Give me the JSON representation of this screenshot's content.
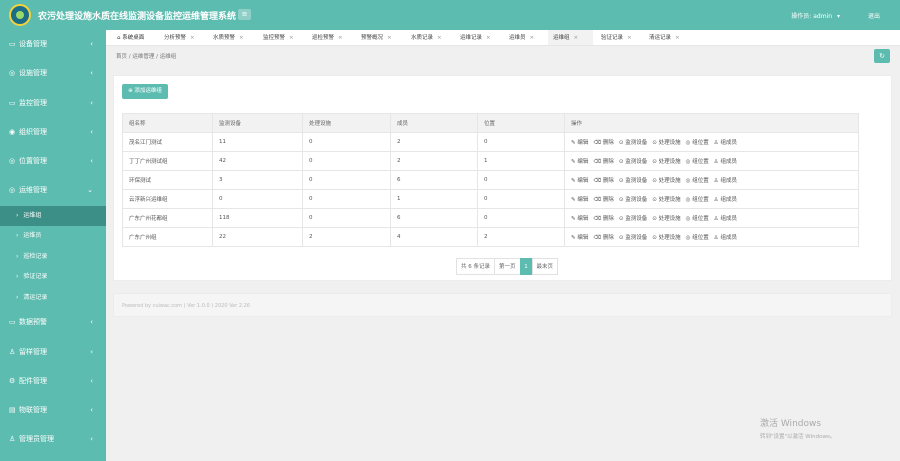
{
  "header": {
    "title": "农污处理设施水质在线监测设备监控运维管理系统",
    "operator_label": "操作员:",
    "user": "admin",
    "logout": "退出"
  },
  "sidebar": {
    "items": [
      {
        "label": "设备管理",
        "icon": "device-icon",
        "sub": []
      },
      {
        "label": "设施管理",
        "icon": "facility-icon",
        "sub": []
      },
      {
        "label": "监控管理",
        "icon": "monitor-icon",
        "sub": []
      },
      {
        "label": "组织管理",
        "icon": "org-icon",
        "sub": []
      },
      {
        "label": "位置管理",
        "icon": "location-icon",
        "sub": []
      },
      {
        "label": "运维管理",
        "icon": "maintenance-icon",
        "expanded": true,
        "sub": [
          {
            "label": "运维组",
            "active": true
          },
          {
            "label": "运维员",
            "active": false
          },
          {
            "label": "巡检记录",
            "active": false
          },
          {
            "label": "验证记录",
            "active": false
          },
          {
            "label": "清运记录",
            "active": false
          }
        ]
      },
      {
        "label": "数据预警",
        "icon": "alert-icon",
        "sub": []
      },
      {
        "label": "留样管理",
        "icon": "sample-icon",
        "sub": []
      },
      {
        "label": "配件管理",
        "icon": "parts-icon",
        "sub": []
      },
      {
        "label": "物联管理",
        "icon": "iot-icon",
        "sub": []
      },
      {
        "label": "管理员管理",
        "icon": "admin-icon",
        "sub": []
      }
    ]
  },
  "tabs": [
    {
      "label": "系统桌面",
      "home": true
    },
    {
      "label": "分析预警"
    },
    {
      "label": "水质预警"
    },
    {
      "label": "监控预警"
    },
    {
      "label": "巡检预警"
    },
    {
      "label": "预警概况"
    },
    {
      "label": "水质记录"
    },
    {
      "label": "运维记录"
    },
    {
      "label": "运维员"
    },
    {
      "label": "运维组",
      "active": true
    },
    {
      "label": "验证记录"
    },
    {
      "label": "清运记录"
    }
  ],
  "breadcrumb": {
    "home": "首页",
    "parent": "运维管理",
    "current": "运维组"
  },
  "add_button": "添加运维组",
  "table": {
    "headers": [
      "组名称",
      "监测设备",
      "处理设施",
      "成员",
      "位置",
      "操作"
    ],
    "actions": [
      "编辑",
      "删除",
      "监测设备",
      "处理设施",
      "组位置",
      "组成员"
    ],
    "rows": [
      {
        "name": "茂名江门测试",
        "monitor": "11",
        "facility": "0",
        "members": "2",
        "location": "0"
      },
      {
        "name": "丁丁广州测试组",
        "monitor": "42",
        "facility": "0",
        "members": "2",
        "location": "1"
      },
      {
        "name": "环保测试",
        "monitor": "3",
        "facility": "0",
        "members": "6",
        "location": "0"
      },
      {
        "name": "云浮新兴运维组",
        "monitor": "0",
        "facility": "0",
        "members": "1",
        "location": "0"
      },
      {
        "name": "广东广州花都组",
        "monitor": "118",
        "facility": "0",
        "members": "6",
        "location": "0"
      },
      {
        "name": "广东广州组",
        "monitor": "22",
        "facility": "2",
        "members": "4",
        "location": "2"
      }
    ]
  },
  "pagination": {
    "total": "共 6 条记录",
    "first": "第一页",
    "current": "1",
    "last": "最末页"
  },
  "footer": "Powered by cuiwac.com ( Ver 1.0.0 ) 2020 Ver 2.26",
  "watermark": {
    "line1": "激活 Windows",
    "line2": "转到\"设置\"以激活 Windows。"
  },
  "colors": {
    "accent": "#5dbcb0",
    "active_sub": "#3b8f86"
  }
}
